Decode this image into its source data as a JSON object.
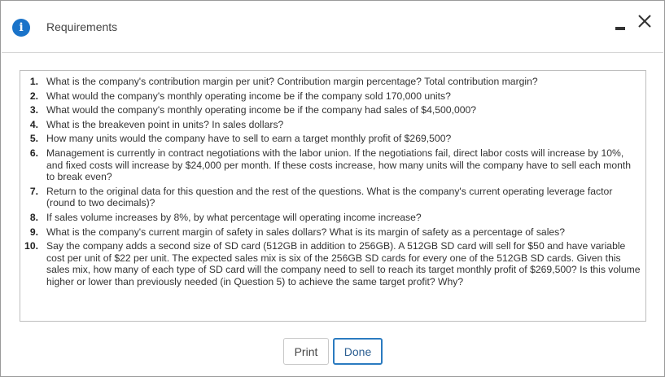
{
  "window": {
    "title": "Requirements",
    "info_icon_glyph": "i"
  },
  "icons": {
    "info": "info-icon",
    "minimize": "minimize-icon",
    "close": "close-icon"
  },
  "colors": {
    "info_icon": "#1a73c9",
    "done_border": "#2b7bc0"
  },
  "questions": [
    {
      "num": "1.",
      "text": "What is the company's contribution margin per unit? Contribution margin percentage? Total contribution margin?"
    },
    {
      "num": "2.",
      "text": "What would the company's monthly operating income be if the company sold 170,000 units?"
    },
    {
      "num": "3.",
      "text": "What would the company's monthly operating income be if the company had sales of $4,500,000?"
    },
    {
      "num": "4.",
      "text": "What is the breakeven point in units? In sales dollars?"
    },
    {
      "num": "5.",
      "text": "How many units would the company have to sell to earn a target monthly profit of $269,500?"
    },
    {
      "num": "6.",
      "text": "Management is currently in contract negotiations with the labor union. If the negotiations fail, direct labor costs will increase by 10%, and fixed costs will increase by $24,000 per month. If these costs increase, how many units will the company have to sell each month to break even?"
    },
    {
      "num": "7.",
      "text": "Return to the original data for this question and the rest of the questions. What is the company's current operating leverage factor (round to two decimals)?"
    },
    {
      "num": "8.",
      "text": "If sales volume increases by 8%, by what percentage will operating income increase?"
    },
    {
      "num": "9.",
      "text": "What is the company's current margin of safety in sales dollars? What is its margin of safety as a percentage of sales?"
    },
    {
      "num": "10.",
      "text": "Say the company adds a second size of SD card (512GB in addition to 256GB). A 512GB SD card will sell for $50 and have variable cost per unit of $22 per unit. The expected sales mix is six of the 256GB SD cards for every one of the 512GB SD cards. Given this sales mix, how many of each type of SD card will the company need to sell to reach its target monthly profit of $269,500? Is this volume higher or lower than previously needed (in Question 5) to achieve the same target profit? Why?"
    }
  ],
  "buttons": {
    "print": "Print",
    "done": "Done"
  }
}
